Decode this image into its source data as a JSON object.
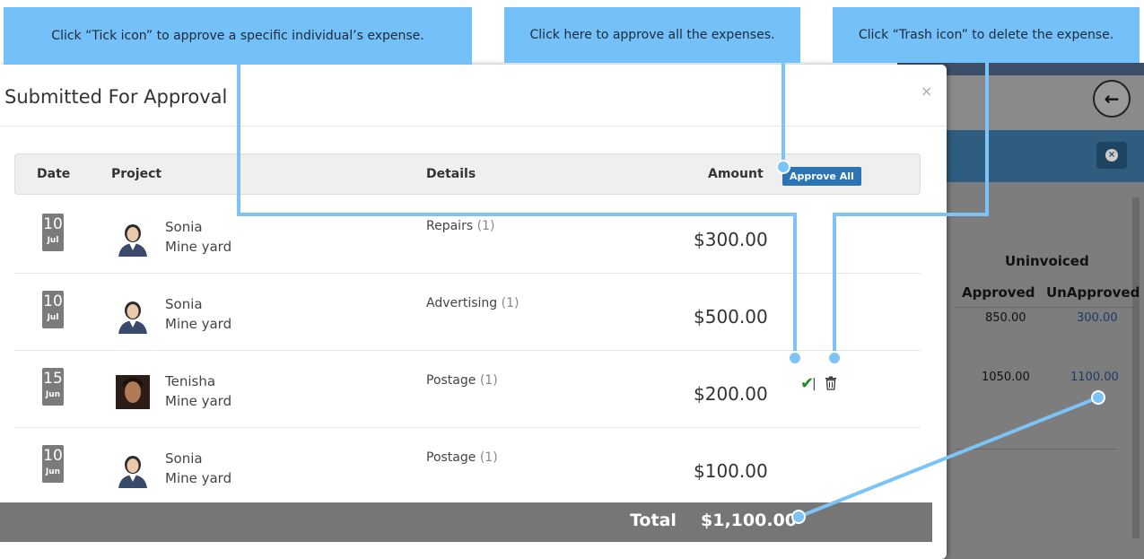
{
  "modal": {
    "title": "Submitted For Approval",
    "close_label": "×",
    "columns": {
      "date": "Date",
      "project": "Project",
      "details": "Details",
      "amount": "Amount"
    },
    "approve_all_label": "Approve All",
    "rows": [
      {
        "day": "10",
        "month": "Jul",
        "name": "Sonia",
        "project": "Mine yard",
        "detail": "Repairs",
        "count": "(1)",
        "amount": "$300.00"
      },
      {
        "day": "10",
        "month": "Jul",
        "name": "Sonia",
        "project": "Mine yard",
        "detail": "Advertising",
        "count": "(1)",
        "amount": "$500.00"
      },
      {
        "day": "15",
        "month": "Jun",
        "name": "Tenisha",
        "project": "Mine yard",
        "detail": "Postage",
        "count": "(1)",
        "amount": "$200.00",
        "tick": "✔",
        "pipe": "|"
      },
      {
        "day": "10",
        "month": "Jun",
        "name": "Sonia",
        "project": "Mine yard",
        "detail": "Postage",
        "count": "(1)",
        "amount": "$100.00"
      }
    ],
    "total_label": "Total",
    "total_value": "$1,100.00"
  },
  "background_app": {
    "uninvoiced_header": "Uninvoiced",
    "approved_header": "Approved",
    "unapproved_header": "UnApproved",
    "values": [
      "850.00",
      "300.00",
      "1050.00",
      "1100.00"
    ],
    "back_icon": "←",
    "close_icon": "×"
  },
  "callouts": {
    "tick": "Click “Tick icon” to approve a specific individual’s expense.",
    "approve_all": "Click here to approve all the expenses.",
    "trash": "Click “Trash icon” to delete the expense."
  },
  "colors": {
    "callout": "#74c0f8",
    "approve_button": "#2d74b5",
    "tick": "#1d8a26",
    "total_bar": "#767676"
  }
}
